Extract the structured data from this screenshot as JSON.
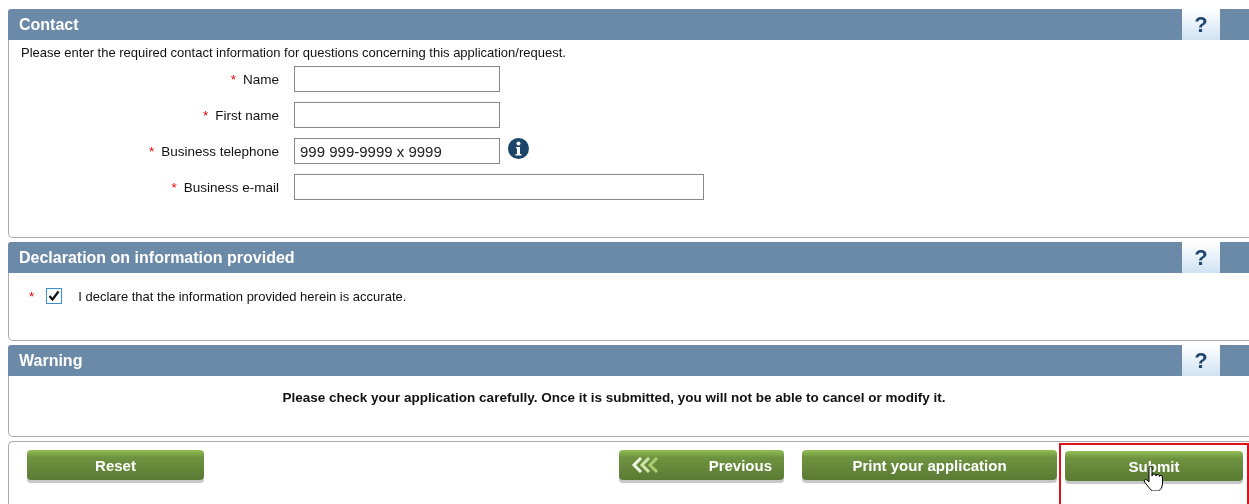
{
  "contact": {
    "title": "Contact",
    "help": "?",
    "intro": "Please enter the required contact information for questions concerning this application/request.",
    "fields": [
      {
        "mark": "*",
        "label": "Name",
        "kind": "short"
      },
      {
        "mark": "*",
        "label": "First name",
        "kind": "short"
      },
      {
        "mark": "*",
        "label": "Business telephone",
        "kind": "short",
        "value": "999 999-9999 x 9999",
        "info": true
      },
      {
        "mark": "*",
        "label": "Business e-mail",
        "kind": "long"
      }
    ]
  },
  "declaration": {
    "title": "Declaration on information provided",
    "help": "?",
    "mark": "*",
    "checked": true,
    "label": "I declare that the information provided herein is accurate."
  },
  "warning": {
    "title": "Warning",
    "help": "?",
    "message": "Please check your application carefully. Once it is submitted, you will not be able to cancel or modify it."
  },
  "buttons": [
    {
      "label": "Reset",
      "kind": "plain",
      "hovered": false
    },
    {
      "label": "Previous",
      "kind": "back",
      "hovered": false
    },
    {
      "label": "Print your application",
      "kind": "plain",
      "hovered": false
    },
    {
      "label": "Submit",
      "kind": "plain",
      "hovered": true
    }
  ]
}
